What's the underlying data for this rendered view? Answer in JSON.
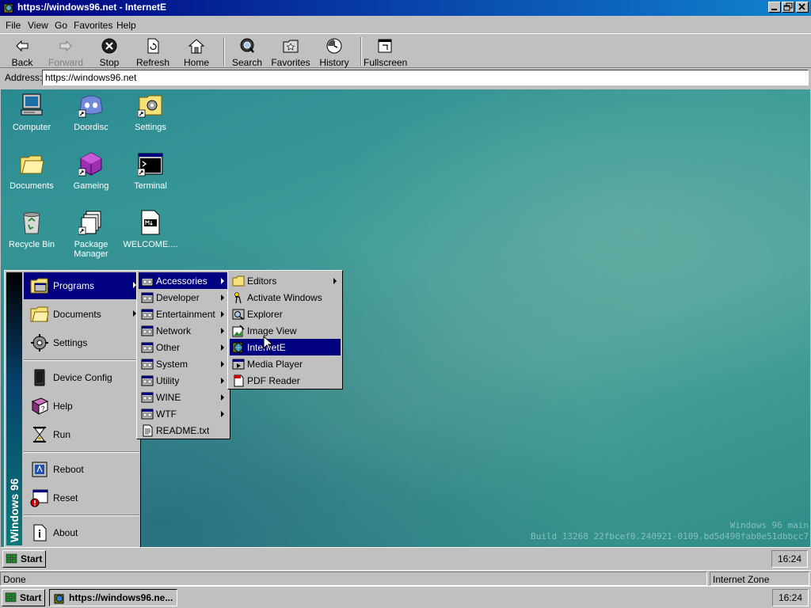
{
  "window": {
    "title": "https://windows96.net - InternetE",
    "caption_buttons": [
      "minimize",
      "restore",
      "close"
    ]
  },
  "menubar": {
    "items": [
      "File",
      "View",
      "Go",
      "Favorites",
      "Help"
    ]
  },
  "toolbar": {
    "buttons": [
      {
        "label": "Back",
        "icon": "back-arrow-icon",
        "enabled": true
      },
      {
        "label": "Forward",
        "icon": "forward-arrow-icon",
        "enabled": false
      },
      {
        "label": "Stop",
        "icon": "stop-icon",
        "enabled": true
      },
      {
        "label": "Refresh",
        "icon": "refresh-icon",
        "enabled": true
      },
      {
        "label": "Home",
        "icon": "home-icon",
        "enabled": true
      },
      {
        "label": "Search",
        "icon": "search-icon",
        "enabled": true
      },
      {
        "label": "Favorites",
        "icon": "favorites-icon",
        "enabled": true
      },
      {
        "label": "History",
        "icon": "history-icon",
        "enabled": true
      },
      {
        "label": "Fullscreen",
        "icon": "fullscreen-icon",
        "enabled": true
      }
    ]
  },
  "address": {
    "label": "Address:",
    "value": "https://windows96.net"
  },
  "desktop": {
    "icons": [
      {
        "label": "Computer",
        "icon": "computer-icon"
      },
      {
        "label": "Doordisc",
        "icon": "doordisc-icon"
      },
      {
        "label": "Settings",
        "icon": "settings-folder-icon"
      },
      {
        "label": "Documents",
        "icon": "documents-folder-icon"
      },
      {
        "label": "Gameing",
        "icon": "gameing-cube-icon"
      },
      {
        "label": "Terminal",
        "icon": "terminal-icon"
      },
      {
        "label": "Recycle Bin",
        "icon": "recycle-bin-icon"
      },
      {
        "label": "Package Manager",
        "icon": "package-manager-icon"
      },
      {
        "label": "WELCOME....",
        "icon": "markdown-file-icon"
      }
    ],
    "watermark_line1": "Windows 96 main",
    "watermark_line2": "Build 13268 22fbcef0.240921-0109.bd5d490fab0e51dbbcc7"
  },
  "startmenu": {
    "banner": "Windows 96",
    "items": [
      {
        "label": "Programs",
        "icon": "programs-icon",
        "submenu": true,
        "selected": true
      },
      {
        "label": "Documents",
        "icon": "documents-icon",
        "submenu": true
      },
      {
        "label": "Settings",
        "icon": "settings-icon",
        "submenu": false
      },
      {
        "label": "Device Config",
        "icon": "device-config-icon",
        "submenu": false
      },
      {
        "label": "Help",
        "icon": "help-book-icon",
        "submenu": false
      },
      {
        "label": "Run",
        "icon": "run-hourglass-icon",
        "submenu": false
      },
      {
        "label": "Reboot",
        "icon": "reboot-icon",
        "submenu": false
      },
      {
        "label": "Reset",
        "icon": "reset-icon",
        "submenu": false
      },
      {
        "label": "About",
        "icon": "about-icon",
        "submenu": false
      }
    ]
  },
  "programs_menu": {
    "items": [
      {
        "label": "Accessories",
        "submenu": true,
        "selected": true
      },
      {
        "label": "Developer",
        "submenu": true
      },
      {
        "label": "Entertainment",
        "submenu": true
      },
      {
        "label": "Network",
        "submenu": true
      },
      {
        "label": "Other",
        "submenu": true
      },
      {
        "label": "System",
        "submenu": true
      },
      {
        "label": "Utility",
        "submenu": true
      },
      {
        "label": "WINE",
        "submenu": true
      },
      {
        "label": "WTF",
        "submenu": true
      },
      {
        "label": "README.txt",
        "submenu": false
      }
    ]
  },
  "accessories_menu": {
    "items": [
      {
        "label": "Editors",
        "submenu": true
      },
      {
        "label": "Activate Windows",
        "submenu": false
      },
      {
        "label": "Explorer",
        "submenu": false
      },
      {
        "label": "Image View",
        "submenu": false
      },
      {
        "label": "InternetE",
        "submenu": false,
        "selected": true
      },
      {
        "label": "Media Player",
        "submenu": false
      },
      {
        "label": "PDF Reader",
        "submenu": false
      }
    ]
  },
  "inner_taskbar": {
    "start_label": "Start",
    "clock": "16:24"
  },
  "statusbar": {
    "status": "Done",
    "zone": "Internet Zone"
  },
  "outer_taskbar": {
    "start_label": "Start",
    "task_label": "https://windows96.ne...",
    "clock": "16:24"
  },
  "colors": {
    "selection": "#000080",
    "face": "#c0c0c0",
    "desktop": "#3d9c98"
  }
}
